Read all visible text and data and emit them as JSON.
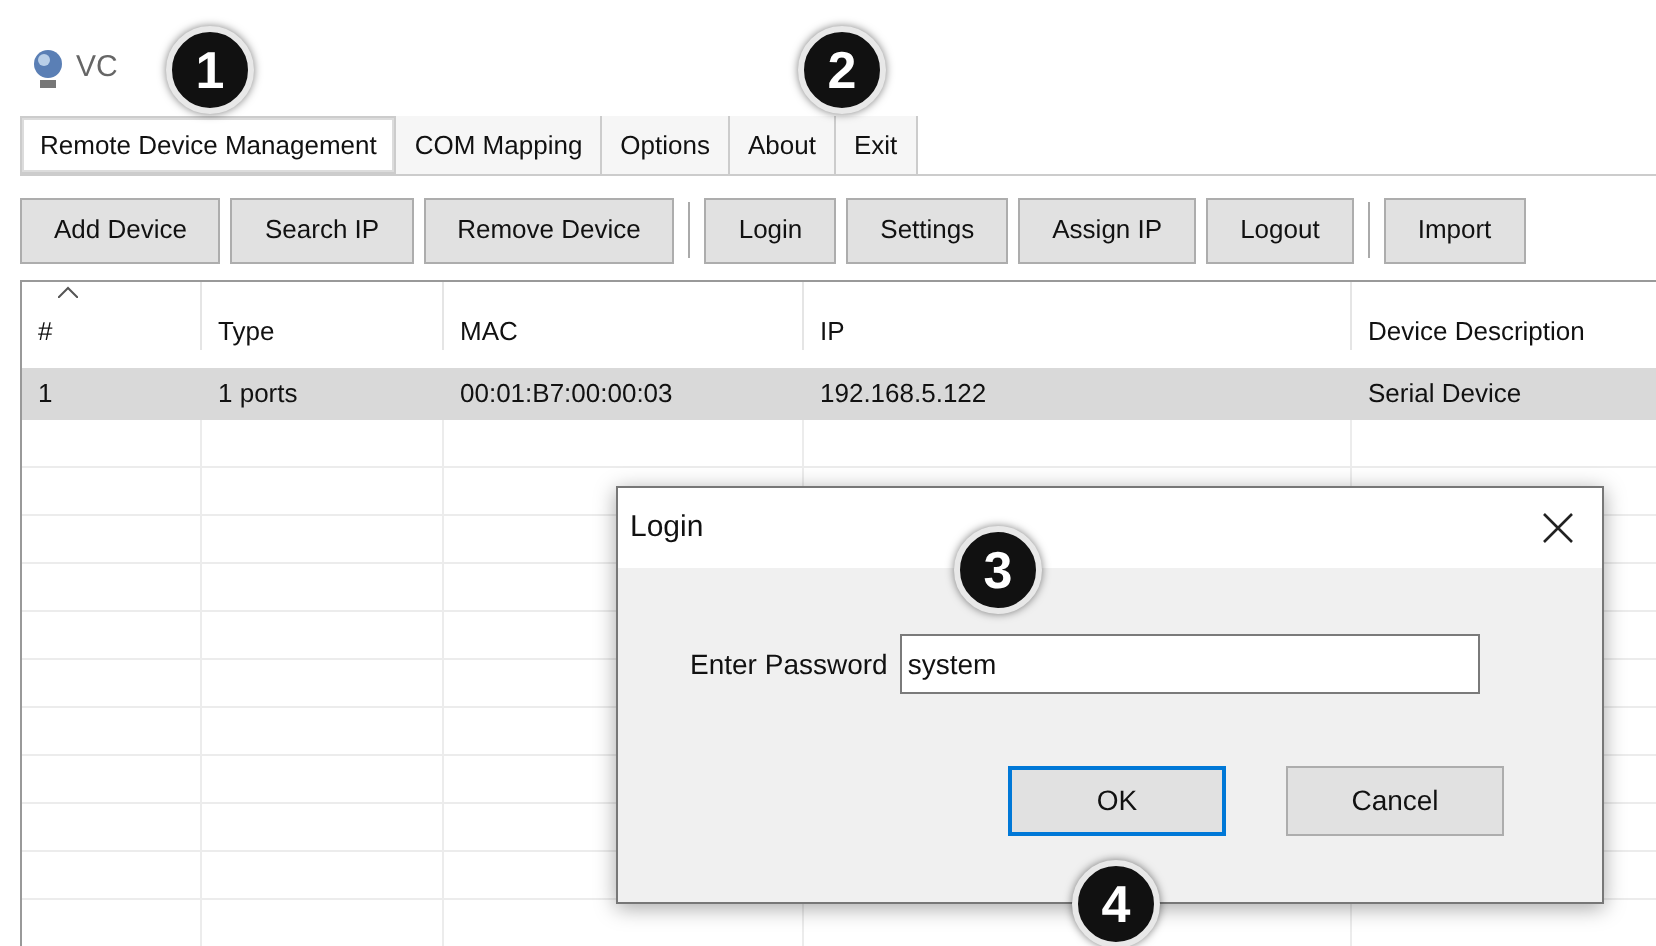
{
  "window": {
    "title": "VC"
  },
  "tabs": [
    {
      "label": "Remote Device Management",
      "selected": true
    },
    {
      "label": "COM Mapping",
      "selected": false
    },
    {
      "label": "Options",
      "selected": false
    },
    {
      "label": "About",
      "selected": false
    },
    {
      "label": "Exit",
      "selected": false
    }
  ],
  "toolbar": [
    [
      "Add Device",
      "Search IP",
      "Remove Device"
    ],
    [
      "Login",
      "Settings",
      "Assign IP",
      "Logout"
    ],
    [
      "Import"
    ]
  ],
  "table": {
    "columns": [
      "#",
      "Type",
      "MAC",
      "IP",
      "Device Description"
    ],
    "rows": [
      {
        "cells": [
          "1",
          "1 ports",
          "00:01:B7:00:00:03",
          "192.168.5.122",
          "Serial Device"
        ],
        "selected": true
      }
    ]
  },
  "dialog": {
    "title": "Login",
    "label": "Enter Password",
    "value": "system",
    "buttons": [
      {
        "label": "OK",
        "focused": true
      },
      {
        "label": "Cancel",
        "focused": false
      }
    ]
  },
  "markers": [
    "1",
    "2",
    "3",
    "4"
  ]
}
